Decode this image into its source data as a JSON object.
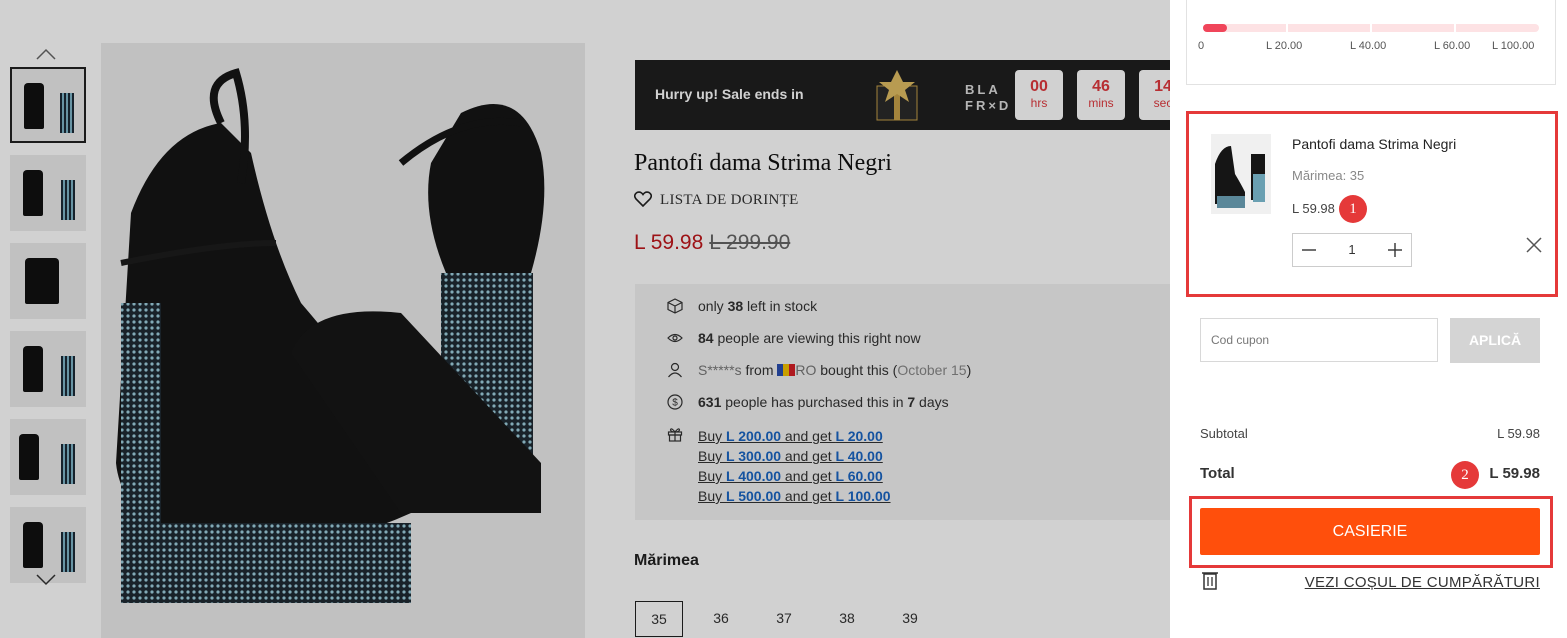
{
  "product": {
    "title": "Pantofi dama Strima Negri",
    "wishlist_label": "LISTA DE DORINȚE",
    "price_now": "L 59.98",
    "price_old": "L 299.90",
    "size_heading": "Mărimea",
    "sizes": [
      "35",
      "36",
      "37",
      "38",
      "39"
    ],
    "selected_size": "35"
  },
  "sale": {
    "text": "Hurry up!  Sale ends in",
    "bf_line1": "BLA",
    "bf_line2": "FR×D",
    "timers": [
      {
        "num": "00",
        "unit": "hrs"
      },
      {
        "num": "46",
        "unit": "mins"
      },
      {
        "num": "14",
        "unit": "sec"
      }
    ]
  },
  "info": {
    "stock_pre": "only ",
    "stock_num": "38",
    "stock_post": " left in stock",
    "viewing_num": "84",
    "viewing_post": " people are viewing this right now",
    "bought_user": "S*****s",
    "bought_from": " from ",
    "bought_country": "RO",
    "bought_mid": " bought this (",
    "bought_date": "October 15",
    "bought_end": ")",
    "purchased_num": "631",
    "purchased_mid": " people has purchased this in ",
    "purchased_days": "7",
    "purchased_end": " days",
    "promos": [
      {
        "buy": "Buy ",
        "amount": "L 200.00",
        "get": " and get ",
        "discount": "L 20.00"
      },
      {
        "buy": "Buy ",
        "amount": "L 300.00",
        "get": " and get ",
        "discount": "L 40.00"
      },
      {
        "buy": "Buy ",
        "amount": "L 400.00",
        "get": " and get ",
        "discount": "L 60.00"
      },
      {
        "buy": "Buy ",
        "amount": "L 500.00",
        "get": " and get ",
        "discount": "L 100.00"
      }
    ]
  },
  "cart": {
    "progress_ticks": [
      "0",
      "L 20.00",
      "L 40.00",
      "L 60.00",
      "L 100.00"
    ],
    "progress_fraction": 0.07,
    "item": {
      "name": "Pantofi dama Strima Negri",
      "size": "Mărimea: 35",
      "price": "L 59.98",
      "qty": "1"
    },
    "coupon_placeholder": "Cod cupon",
    "apply_label": "APLICĂ",
    "subtotal_label": "Subtotal",
    "subtotal_value": "L 59.98",
    "total_label": "Total",
    "total_value": "L 59.98",
    "checkout_label": "CASIERIE",
    "view_cart_label": "VEZI COȘUL DE CUMPĂRĂTURI"
  },
  "annotations": [
    "1",
    "2"
  ],
  "colors": {
    "checkout": "#ff4f0c",
    "annotation": "#e53939",
    "price": "#c0171c",
    "progress": "#f0455a",
    "link": "#1a66c4"
  }
}
